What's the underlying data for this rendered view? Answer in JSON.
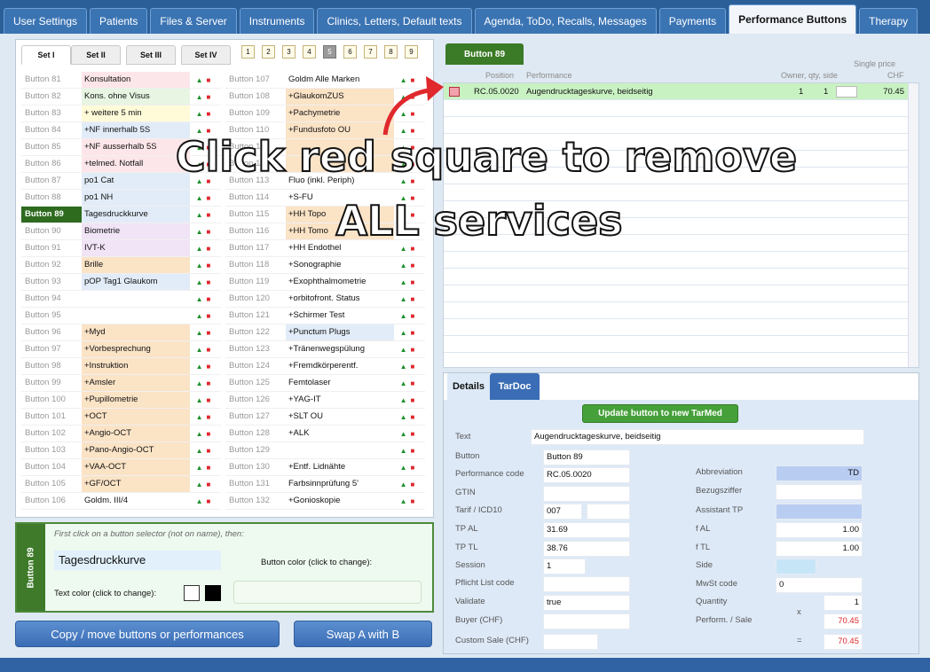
{
  "tabs": [
    "User Settings",
    "Patients",
    "Files & Server",
    "Instruments",
    "Clinics, Letters, Default texts",
    "Agenda, ToDo, Recalls, Messages",
    "Payments",
    "Performance Buttons",
    "Therapy"
  ],
  "active_tab": "Performance Buttons",
  "sets": [
    "Set I",
    "Set II",
    "Set III",
    "Set IV"
  ],
  "number_selectors": [
    "1",
    "2",
    "3",
    "4",
    "5",
    "6",
    "7",
    "8",
    "9"
  ],
  "updown": {
    "up": "▲",
    "down": "■"
  },
  "left_buttons": [
    {
      "name": "Button 81",
      "perf": "Konsultation",
      "color": "pink"
    },
    {
      "name": "Button 82",
      "perf": "Kons. ohne Visus",
      "color": "green"
    },
    {
      "name": "Button 83",
      "perf": "+ weitere 5 min",
      "color": "yellow"
    },
    {
      "name": "Button 84",
      "perf": "+NF innerhalb 5S",
      "color": "blue"
    },
    {
      "name": "Button 85",
      "perf": "+NF ausserhalb 5S",
      "color": "pink"
    },
    {
      "name": "Button 86",
      "perf": "+telmed. Notfall",
      "color": "pink"
    },
    {
      "name": "Button 87",
      "perf": "po1 Cat",
      "color": "blue"
    },
    {
      "name": "Button 88",
      "perf": "po1 NH",
      "color": "blue"
    },
    {
      "name": "Button 89",
      "perf": "Tagesdruckkurve",
      "color": "blue",
      "selected": true
    },
    {
      "name": "Button 90",
      "perf": "Biometrie",
      "color": "lilac"
    },
    {
      "name": "Button 91",
      "perf": "IVT-K",
      "color": "lilac"
    },
    {
      "name": "Button 92",
      "perf": "Brille",
      "color": "peach"
    },
    {
      "name": "Button 93",
      "perf": "pOP Tag1 Glaukom",
      "color": "blue"
    },
    {
      "name": "Button 94",
      "perf": "",
      "color": "white"
    },
    {
      "name": "Button 95",
      "perf": "",
      "color": "white"
    },
    {
      "name": "Button 96",
      "perf": "+Myd",
      "color": "peach"
    },
    {
      "name": "Button 97",
      "perf": "+Vorbesprechung",
      "color": "peach"
    },
    {
      "name": "Button 98",
      "perf": "+Instruktion",
      "color": "peach"
    },
    {
      "name": "Button 99",
      "perf": "+Amsler",
      "color": "peach"
    },
    {
      "name": "Button 100",
      "perf": "+Pupillometrie",
      "color": "peach"
    },
    {
      "name": "Button 101",
      "perf": "+OCT",
      "color": "peach"
    },
    {
      "name": "Button 102",
      "perf": "+Angio-OCT",
      "color": "peach"
    },
    {
      "name": "Button 103",
      "perf": "+Pano-Angio-OCT",
      "color": "peach"
    },
    {
      "name": "Button 104",
      "perf": "+VAA-OCT",
      "color": "peach"
    },
    {
      "name": "Button 105",
      "perf": "+GF/OCT",
      "color": "peach"
    },
    {
      "name": "Button 106",
      "perf": "Goldm. III/4",
      "color": "white"
    }
  ],
  "right_buttons": [
    {
      "name": "Button 107",
      "perf": "Goldm Alle Marken",
      "color": "white"
    },
    {
      "name": "Button 108",
      "perf": "+GlaukomZUS",
      "color": "peach"
    },
    {
      "name": "Button 109",
      "perf": "+Pachymetrie",
      "color": "peach"
    },
    {
      "name": "Button 110",
      "perf": "+Fundusfoto OU",
      "color": "peach"
    },
    {
      "name": "Button 111",
      "perf": "",
      "color": "peach"
    },
    {
      "name": "Button 112",
      "perf": "",
      "color": "peach"
    },
    {
      "name": "Button 113",
      "perf": "Fluo (inkl. Periph)",
      "color": "white"
    },
    {
      "name": "Button 114",
      "perf": "+S-FU",
      "color": "white"
    },
    {
      "name": "Button 115",
      "perf": "+HH Topo",
      "color": "peach"
    },
    {
      "name": "Button 116",
      "perf": "+HH Tomo",
      "color": "peach"
    },
    {
      "name": "Button 117",
      "perf": "+HH Endothel",
      "color": "white"
    },
    {
      "name": "Button 118",
      "perf": "+Sonographie",
      "color": "white"
    },
    {
      "name": "Button 119",
      "perf": "+Exophthalmometrie",
      "color": "white"
    },
    {
      "name": "Button 120",
      "perf": "+orbitofront. Status",
      "color": "white"
    },
    {
      "name": "Button 121",
      "perf": "+Schirmer Test",
      "color": "white"
    },
    {
      "name": "Button 122",
      "perf": "+Punctum Plugs",
      "color": "blue"
    },
    {
      "name": "Button 123",
      "perf": "+Tränenwegspülung",
      "color": "white"
    },
    {
      "name": "Button 124",
      "perf": "+Fremdkörperentf.",
      "color": "white"
    },
    {
      "name": "Button 125",
      "perf": "Femtolaser",
      "color": "white"
    },
    {
      "name": "Button 126",
      "perf": "+YAG-IT",
      "color": "white"
    },
    {
      "name": "Button 127",
      "perf": "+SLT OU",
      "color": "white"
    },
    {
      "name": "Button 128",
      "perf": "+ALK",
      "color": "white"
    },
    {
      "name": "Button 129",
      "perf": "",
      "color": "white"
    },
    {
      "name": "Button 130",
      "perf": "+Entf. Lidnähte",
      "color": "white"
    },
    {
      "name": "Button 131",
      "perf": "Farbsinnprüfung 5'",
      "color": "white"
    },
    {
      "name": "Button 132",
      "perf": "+Gonioskopie",
      "color": "white"
    }
  ],
  "edit": {
    "side_label": "Button 89",
    "hint": "First click on a button selector (not on name), then:",
    "name_value": "Tagesdruckkurve",
    "button_color_label": "Button color (click to change):",
    "text_color_label": "Text color (click to change):"
  },
  "actions": {
    "copy": "Copy / move buttons or performances",
    "swap": "Swap A with B"
  },
  "perf_panel": {
    "title": "Button 89",
    "h_position": "Position",
    "h_performance": "Performance",
    "h_owner": "Owner, qty, side",
    "h_single": "Single price",
    "h_chf": "CHF"
  },
  "perf_row": {
    "position": "RC.05.0020",
    "performance": "Augendrucktageskurve, beidseitig",
    "owner": "1",
    "qty": "1",
    "price": "70.45"
  },
  "detail_tabs": [
    "Details",
    "TarDoc"
  ],
  "detail": {
    "update_button": "Update button to new TarMed",
    "labels": {
      "text": "Text",
      "button": "Button",
      "perf_code": "Performance code",
      "gtin": "GTIN",
      "tarif": "Tarif / ICD10",
      "tp_al": "TP AL",
      "tp_tl": "TP TL",
      "session": "Session",
      "pflicht": "Pflicht List code",
      "validate": "Validate",
      "buyer": "Buyer (CHF)",
      "custom": "Custom Sale (CHF)",
      "abbr": "Abbreviation",
      "bezug": "Bezugsziffer",
      "assist": "Assistant TP",
      "f_al": "f AL",
      "f_tl": "f TL",
      "side": "Side",
      "mwst": "MwSt code",
      "quantity": "Quantity",
      "perf_sale": "Perform. / Sale"
    },
    "values": {
      "text": "Augendrucktageskurve, beidseitig",
      "button": "Button 89",
      "perf_code": "RC.05.0020",
      "tarif": "007",
      "tp_al": "31.69",
      "tp_tl": "38.76",
      "session": "1",
      "validate": "true",
      "abbr": "TD",
      "f_al": "1.00",
      "f_tl": "1.00",
      "mwst": "0",
      "quantity": "1",
      "perf_sale": "70.45",
      "custom": "70.45",
      "times": "x",
      "equals": "="
    }
  },
  "overlay": {
    "line1": "Click red square to remove",
    "line2": "ALL services"
  }
}
